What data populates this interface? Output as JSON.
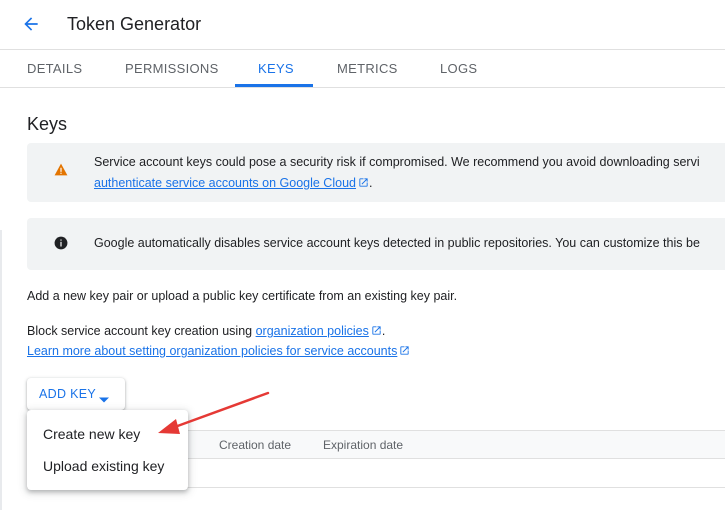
{
  "header": {
    "title": "Token Generator",
    "back_icon": "arrow-back-icon"
  },
  "tabs": [
    {
      "label": "DETAILS",
      "active": false
    },
    {
      "label": "PERMISSIONS",
      "active": false
    },
    {
      "label": "KEYS",
      "active": true
    },
    {
      "label": "METRICS",
      "active": false
    },
    {
      "label": "LOGS",
      "active": false
    }
  ],
  "section": {
    "title": "Keys"
  },
  "warning_banner": {
    "icon": "warning-icon",
    "line1": "Service account keys could pose a security risk if compromised. We recommend you avoid downloading servi",
    "line2_link": "authenticate service accounts on Google Cloud",
    "line2_suffix": "."
  },
  "info_banner": {
    "icon": "info-icon",
    "line1": "Google automatically disables service account keys detected in public repositories. You can customize this be"
  },
  "body": {
    "intro": "Add a new key pair or upload a public key certificate from an existing key pair.",
    "block_prefix": "Block service account key creation using ",
    "block_link": "organization policies",
    "block_suffix": ".",
    "learn_more_link": "Learn more about setting organization policies for service accounts"
  },
  "add_key": {
    "label": "ADD KEY",
    "caret_icon": "caret-down-icon"
  },
  "menu": {
    "items": [
      {
        "label": "Create new key"
      },
      {
        "label": "Upload existing key"
      }
    ]
  },
  "table": {
    "columns": [
      "Creation date",
      "Expiration date"
    ]
  },
  "colors": {
    "accent": "#1a73e8",
    "warning": "#e37400",
    "annotation_arrow": "#e53935",
    "banner_bg": "#f1f3f4"
  }
}
